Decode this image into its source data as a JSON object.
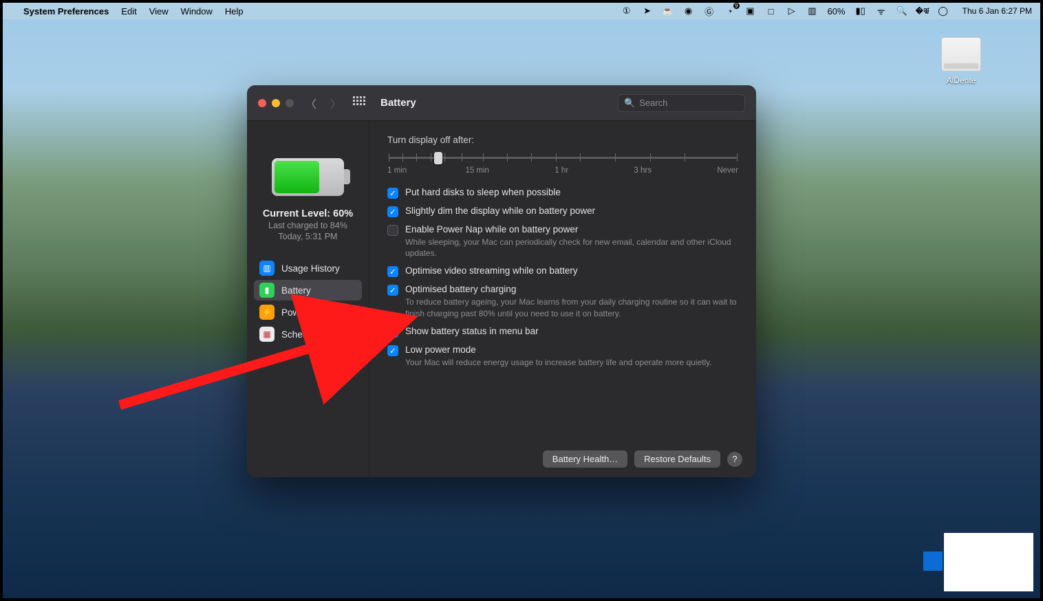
{
  "menubar": {
    "app": "System Preferences",
    "items": [
      "Edit",
      "View",
      "Window",
      "Help"
    ],
    "battery_pct": "60%",
    "datetime": "Thu 6 Jan  6:27 PM",
    "badge": "9"
  },
  "desktop": {
    "disk_label": "AlDente"
  },
  "window": {
    "title": "Battery",
    "search_placeholder": "Search"
  },
  "sidebar": {
    "current_level": "Current Level: 60%",
    "last_charged": "Last charged to 84%",
    "last_charged_time": "Today, 5:31 PM",
    "items": [
      {
        "label": "Usage History"
      },
      {
        "label": "Battery"
      },
      {
        "label": "Power Adapter"
      },
      {
        "label": "Schedule"
      }
    ]
  },
  "content": {
    "slider_label": "Turn display off after:",
    "slider_ticks": [
      "1 min",
      "15 min",
      "1 hr",
      "3 hrs",
      "Never"
    ],
    "checks": [
      {
        "label": "Put hard disks to sleep when possible",
        "checked": true
      },
      {
        "label": "Slightly dim the display while on battery power",
        "checked": true
      },
      {
        "label": "Enable Power Nap while on battery power",
        "checked": false,
        "desc": "While sleeping, your Mac can periodically check for new email, calendar and other iCloud updates."
      },
      {
        "label": "Optimise video streaming while on battery",
        "checked": true
      },
      {
        "label": "Optimised battery charging",
        "checked": true,
        "desc": "To reduce battery ageing, your Mac learns from your daily charging routine so it can wait to finish charging past 80% until you need to use it on battery."
      },
      {
        "label": "Show battery status in menu bar",
        "checked": true
      },
      {
        "label": "Low power mode",
        "checked": true,
        "desc": "Your Mac will reduce energy usage to increase battery life and operate more quietly."
      }
    ],
    "buttons": {
      "health": "Battery Health…",
      "restore": "Restore Defaults"
    }
  }
}
